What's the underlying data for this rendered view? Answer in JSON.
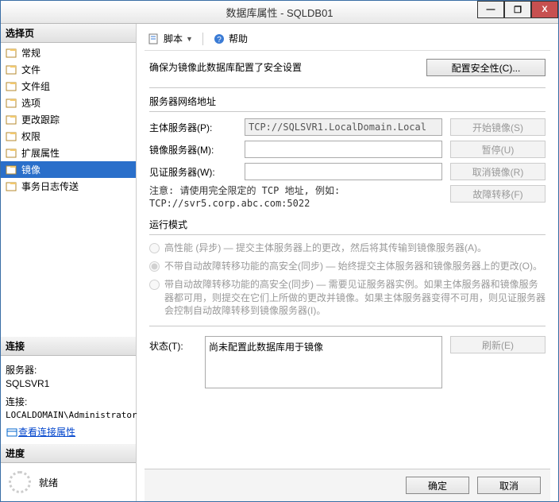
{
  "window": {
    "title": "数据库属性 - SQLDB01"
  },
  "titlebar": {
    "minimize": "—",
    "maximize": "❐",
    "close": "X"
  },
  "left": {
    "select_header": "选择页",
    "pages": [
      {
        "label": "常规"
      },
      {
        "label": "文件"
      },
      {
        "label": "文件组"
      },
      {
        "label": "选项"
      },
      {
        "label": "更改跟踪"
      },
      {
        "label": "权限"
      },
      {
        "label": "扩展属性"
      },
      {
        "label": "镜像",
        "selected": true
      },
      {
        "label": "事务日志传送"
      }
    ],
    "conn_header": "连接",
    "conn": {
      "server_label": "服务器:",
      "server_value": "SQLSVR1",
      "conn_label": "连接:",
      "conn_value": "LOCALDOMAIN\\Administrator",
      "view_link": "查看连接属性"
    },
    "progress_header": "进度",
    "progress": {
      "status": "就绪"
    }
  },
  "toolbar": {
    "script": "脚本",
    "help": "帮助"
  },
  "content": {
    "intro": "确保为镜像此数据库配置了安全设置",
    "configure_btn": "配置安全性(C)...",
    "net_title": "服务器网络地址",
    "principal_label": "主体服务器(P):",
    "principal_value": "TCP://SQLSVR1.LocalDomain.Local",
    "mirror_label": "镜像服务器(M):",
    "witness_label": "见证服务器(W):",
    "start_btn": "开始镜像(S)",
    "pause_btn": "暂停(U)",
    "remove_btn": "取消镜像(R)",
    "failover_btn": "故障转移(F)",
    "note": "注意: 请使用完全限定的 TCP 地址, 例如:\nTCP://svr5.corp.abc.com:5022",
    "mode_title": "运行模式",
    "mode_high_perf": "高性能 (异步) — 提交主体服务器上的更改，然后将其传输到镜像服务器(A)。",
    "mode_high_safe_no": "不带自动故障转移功能的高安全(同步) — 始终提交主体服务器和镜像服务器上的更改(O)。",
    "mode_high_safe_yes": "带自动故障转移功能的高安全(同步) — 需要见证服务器实例。如果主体服务器和镜像服务器都可用，则提交在它们上所做的更改并镜像。如果主体服务器变得不可用，则见证服务器会控制自动故障转移到镜像服务器(I)。",
    "status_label": "状态(T):",
    "status_value": "尚未配置此数据库用于镜像",
    "refresh_btn": "刷新(E)"
  },
  "footer": {
    "ok": "确定",
    "cancel": "取消"
  }
}
